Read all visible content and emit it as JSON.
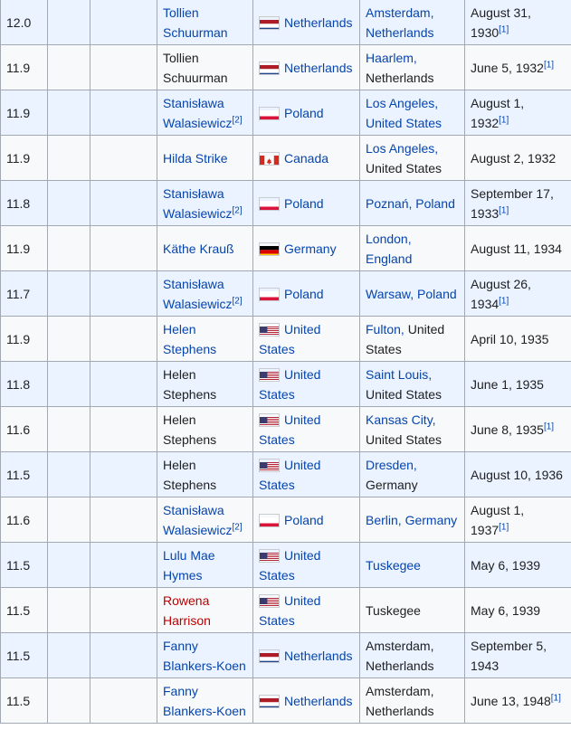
{
  "rows": [
    {
      "time": "12.0",
      "athlete": "Tollien Schuurman",
      "athlete_link": true,
      "athlete_sup": "",
      "flag": "nl",
      "country": "Netherlands",
      "venue_parts": [
        {
          "text": "Amsterdam, Netherlands",
          "link": true
        }
      ],
      "date": "August 31, 1930",
      "date_sup": "[1]"
    },
    {
      "time": "11.9",
      "athlete": "Tollien Schuurman",
      "athlete_link": false,
      "athlete_sup": "",
      "flag": "nl",
      "country": "Netherlands",
      "venue_parts": [
        {
          "text": "Haarlem,",
          "link": true
        },
        {
          "text": " Netherlands",
          "link": false
        }
      ],
      "date": "June 5, 1932",
      "date_sup": "[1]"
    },
    {
      "time": "11.9",
      "athlete": "Stanisława Walasiewicz",
      "athlete_link": true,
      "athlete_sup": "[2]",
      "flag": "pl",
      "country": "Poland",
      "venue_parts": [
        {
          "text": "Los Angeles, United States",
          "link": true
        }
      ],
      "date": "August 1, 1932",
      "date_sup": "[1]"
    },
    {
      "time": "11.9",
      "athlete": "Hilda Strike",
      "athlete_link": true,
      "athlete_sup": "",
      "flag": "ca",
      "country": "Canada",
      "venue_parts": [
        {
          "text": "Los Angeles,",
          "link": true
        },
        {
          "text": " United States",
          "link": false
        }
      ],
      "date": "August 2, 1932",
      "date_sup": ""
    },
    {
      "time": "11.8",
      "athlete": "Stanisława Walasiewicz",
      "athlete_link": true,
      "athlete_sup": "[2]",
      "flag": "pl",
      "country": "Poland",
      "venue_parts": [
        {
          "text": "Poznań, Poland",
          "link": true
        }
      ],
      "date": "September 17, 1933",
      "date_sup": "[1]"
    },
    {
      "time": "11.9",
      "athlete": "Käthe Krauß",
      "athlete_link": true,
      "athlete_sup": "",
      "flag": "de",
      "country": "Germany",
      "venue_parts": [
        {
          "text": "London, England",
          "link": true
        }
      ],
      "date": "August 11, 1934",
      "date_sup": ""
    },
    {
      "time": "11.7",
      "athlete": "Stanisława Walasiewicz",
      "athlete_link": true,
      "athlete_sup": "[2]",
      "flag": "pl",
      "country": "Poland",
      "venue_parts": [
        {
          "text": "Warsaw, Poland",
          "link": true
        }
      ],
      "date": "August 26, 1934",
      "date_sup": "[1]"
    },
    {
      "time": "11.9",
      "athlete": "Helen Stephens",
      "athlete_link": true,
      "athlete_sup": "",
      "flag": "us",
      "country": "United States",
      "venue_parts": [
        {
          "text": "Fulton,",
          "link": true
        },
        {
          "text": " United States",
          "link": false
        }
      ],
      "date": "April 10, 1935",
      "date_sup": ""
    },
    {
      "time": "11.8",
      "athlete": "Helen Stephens",
      "athlete_link": false,
      "athlete_sup": "",
      "flag": "us",
      "country": "United States",
      "venue_parts": [
        {
          "text": "Saint Louis,",
          "link": true
        },
        {
          "text": " United States",
          "link": false
        }
      ],
      "date": "June 1, 1935",
      "date_sup": ""
    },
    {
      "time": "11.6",
      "athlete": "Helen Stephens",
      "athlete_link": false,
      "athlete_sup": "",
      "flag": "us",
      "country": "United States",
      "venue_parts": [
        {
          "text": "Kansas City,",
          "link": true
        },
        {
          "text": " United States",
          "link": false
        }
      ],
      "date": "June 8, 1935",
      "date_sup": "[1]"
    },
    {
      "time": "11.5",
      "athlete": "Helen Stephens",
      "athlete_link": false,
      "athlete_sup": "",
      "flag": "us",
      "country": "United States",
      "venue_parts": [
        {
          "text": "Dresden,",
          "link": true
        },
        {
          "text": " Germany",
          "link": false
        }
      ],
      "date": "August 10, 1936",
      "date_sup": ""
    },
    {
      "time": "11.6",
      "athlete": "Stanisława Walasiewicz",
      "athlete_link": true,
      "athlete_sup": "[2]",
      "flag": "pl",
      "country": "Poland",
      "venue_parts": [
        {
          "text": "Berlin, Germany",
          "link": true
        }
      ],
      "date": "August 1, 1937",
      "date_sup": "[1]"
    },
    {
      "time": "11.5",
      "athlete": "Lulu Mae Hymes",
      "athlete_link": true,
      "athlete_sup": "",
      "flag": "us",
      "country": "United States",
      "venue_parts": [
        {
          "text": "Tuskegee",
          "link": true
        }
      ],
      "date": "May 6, 1939",
      "date_sup": ""
    },
    {
      "time": "11.5",
      "athlete": "Rowena Harrison",
      "athlete_link": "red",
      "athlete_sup": "",
      "flag": "us",
      "country": "United States",
      "venue_parts": [
        {
          "text": "Tuskegee",
          "link": false
        }
      ],
      "date": "May 6, 1939",
      "date_sup": ""
    },
    {
      "time": "11.5",
      "athlete": "Fanny Blankers-Koen",
      "athlete_link": true,
      "athlete_sup": "",
      "flag": "nl",
      "country": "Netherlands",
      "venue_parts": [
        {
          "text": "Amsterdam, Netherlands",
          "link": false
        }
      ],
      "date": "September 5, 1943",
      "date_sup": ""
    },
    {
      "time": "11.5",
      "athlete": "Fanny Blankers-Koen",
      "athlete_link": true,
      "athlete_sup": "",
      "flag": "nl",
      "country": "Netherlands",
      "venue_parts": [
        {
          "text": "Amsterdam, Netherlands",
          "link": false
        }
      ],
      "date": "June 13, 1948",
      "date_sup": "[1]"
    }
  ],
  "colors": {
    "link": "#0645ad",
    "redlink": "#ba0000",
    "row_odd": "#eaf3ff",
    "row_even": "#f8f9fa",
    "border": "#a2a9b1"
  }
}
